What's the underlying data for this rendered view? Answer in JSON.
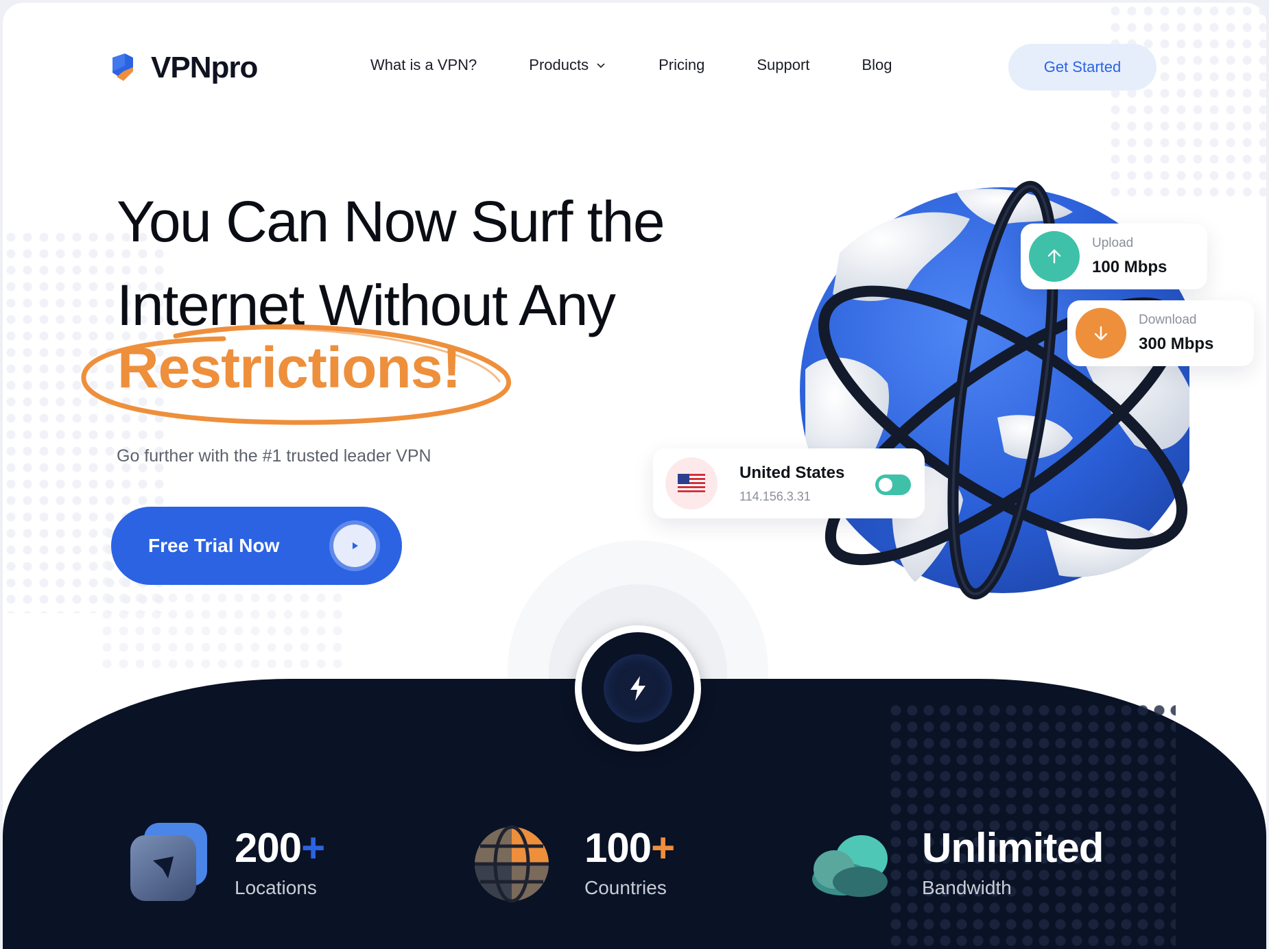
{
  "brand": {
    "name": "VPNpro"
  },
  "nav": {
    "items": [
      {
        "label": "What is a VPN?"
      },
      {
        "label": "Products"
      },
      {
        "label": "Pricing"
      },
      {
        "label": "Support"
      },
      {
        "label": "Blog"
      }
    ],
    "cta": "Get Started"
  },
  "hero": {
    "line1": "You Can Now Surf the",
    "line2": "Internet Without Any",
    "highlight": "Restrictions!",
    "subtitle": "Go further with the #1 trusted leader VPN",
    "button": "Free Trial Now"
  },
  "upload": {
    "title": "Upload",
    "value": "100 Mbps"
  },
  "download": {
    "title": "Download",
    "value": "300 Mbps"
  },
  "location": {
    "country": "United States",
    "ip": "114.156.3.31",
    "connected": true
  },
  "stats": [
    {
      "number": "200",
      "plus": "+",
      "label": "Locations"
    },
    {
      "number": "100",
      "plus": "+",
      "label": "Countries"
    },
    {
      "number": "Unlimited",
      "plus": "",
      "label": "Bandwidth"
    }
  ],
  "colors": {
    "primary": "#2b63e3",
    "accent": "#ee8f3c",
    "teal": "#3ec1a8",
    "dark": "#0a1226"
  }
}
